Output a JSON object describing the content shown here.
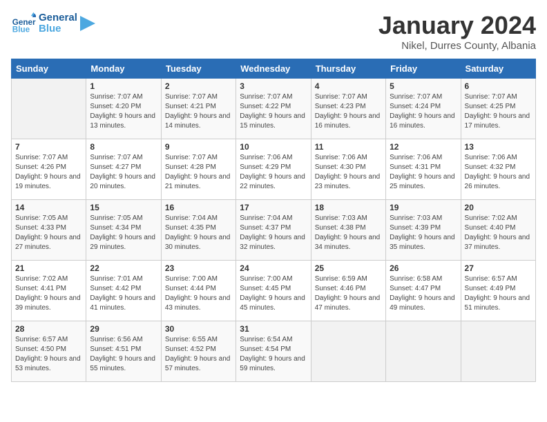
{
  "logo": {
    "text_general": "General",
    "text_blue": "Blue"
  },
  "header": {
    "month_year": "January 2024",
    "location": "Nikel, Durres County, Albania"
  },
  "days_of_week": [
    "Sunday",
    "Monday",
    "Tuesday",
    "Wednesday",
    "Thursday",
    "Friday",
    "Saturday"
  ],
  "weeks": [
    [
      {
        "day": "",
        "sunrise": "",
        "sunset": "",
        "daylight": ""
      },
      {
        "day": "1",
        "sunrise": "Sunrise: 7:07 AM",
        "sunset": "Sunset: 4:20 PM",
        "daylight": "Daylight: 9 hours and 13 minutes."
      },
      {
        "day": "2",
        "sunrise": "Sunrise: 7:07 AM",
        "sunset": "Sunset: 4:21 PM",
        "daylight": "Daylight: 9 hours and 14 minutes."
      },
      {
        "day": "3",
        "sunrise": "Sunrise: 7:07 AM",
        "sunset": "Sunset: 4:22 PM",
        "daylight": "Daylight: 9 hours and 15 minutes."
      },
      {
        "day": "4",
        "sunrise": "Sunrise: 7:07 AM",
        "sunset": "Sunset: 4:23 PM",
        "daylight": "Daylight: 9 hours and 16 minutes."
      },
      {
        "day": "5",
        "sunrise": "Sunrise: 7:07 AM",
        "sunset": "Sunset: 4:24 PM",
        "daylight": "Daylight: 9 hours and 16 minutes."
      },
      {
        "day": "6",
        "sunrise": "Sunrise: 7:07 AM",
        "sunset": "Sunset: 4:25 PM",
        "daylight": "Daylight: 9 hours and 17 minutes."
      }
    ],
    [
      {
        "day": "7",
        "sunrise": "Sunrise: 7:07 AM",
        "sunset": "Sunset: 4:26 PM",
        "daylight": "Daylight: 9 hours and 19 minutes."
      },
      {
        "day": "8",
        "sunrise": "Sunrise: 7:07 AM",
        "sunset": "Sunset: 4:27 PM",
        "daylight": "Daylight: 9 hours and 20 minutes."
      },
      {
        "day": "9",
        "sunrise": "Sunrise: 7:07 AM",
        "sunset": "Sunset: 4:28 PM",
        "daylight": "Daylight: 9 hours and 21 minutes."
      },
      {
        "day": "10",
        "sunrise": "Sunrise: 7:06 AM",
        "sunset": "Sunset: 4:29 PM",
        "daylight": "Daylight: 9 hours and 22 minutes."
      },
      {
        "day": "11",
        "sunrise": "Sunrise: 7:06 AM",
        "sunset": "Sunset: 4:30 PM",
        "daylight": "Daylight: 9 hours and 23 minutes."
      },
      {
        "day": "12",
        "sunrise": "Sunrise: 7:06 AM",
        "sunset": "Sunset: 4:31 PM",
        "daylight": "Daylight: 9 hours and 25 minutes."
      },
      {
        "day": "13",
        "sunrise": "Sunrise: 7:06 AM",
        "sunset": "Sunset: 4:32 PM",
        "daylight": "Daylight: 9 hours and 26 minutes."
      }
    ],
    [
      {
        "day": "14",
        "sunrise": "Sunrise: 7:05 AM",
        "sunset": "Sunset: 4:33 PM",
        "daylight": "Daylight: 9 hours and 27 minutes."
      },
      {
        "day": "15",
        "sunrise": "Sunrise: 7:05 AM",
        "sunset": "Sunset: 4:34 PM",
        "daylight": "Daylight: 9 hours and 29 minutes."
      },
      {
        "day": "16",
        "sunrise": "Sunrise: 7:04 AM",
        "sunset": "Sunset: 4:35 PM",
        "daylight": "Daylight: 9 hours and 30 minutes."
      },
      {
        "day": "17",
        "sunrise": "Sunrise: 7:04 AM",
        "sunset": "Sunset: 4:37 PM",
        "daylight": "Daylight: 9 hours and 32 minutes."
      },
      {
        "day": "18",
        "sunrise": "Sunrise: 7:03 AM",
        "sunset": "Sunset: 4:38 PM",
        "daylight": "Daylight: 9 hours and 34 minutes."
      },
      {
        "day": "19",
        "sunrise": "Sunrise: 7:03 AM",
        "sunset": "Sunset: 4:39 PM",
        "daylight": "Daylight: 9 hours and 35 minutes."
      },
      {
        "day": "20",
        "sunrise": "Sunrise: 7:02 AM",
        "sunset": "Sunset: 4:40 PM",
        "daylight": "Daylight: 9 hours and 37 minutes."
      }
    ],
    [
      {
        "day": "21",
        "sunrise": "Sunrise: 7:02 AM",
        "sunset": "Sunset: 4:41 PM",
        "daylight": "Daylight: 9 hours and 39 minutes."
      },
      {
        "day": "22",
        "sunrise": "Sunrise: 7:01 AM",
        "sunset": "Sunset: 4:42 PM",
        "daylight": "Daylight: 9 hours and 41 minutes."
      },
      {
        "day": "23",
        "sunrise": "Sunrise: 7:00 AM",
        "sunset": "Sunset: 4:44 PM",
        "daylight": "Daylight: 9 hours and 43 minutes."
      },
      {
        "day": "24",
        "sunrise": "Sunrise: 7:00 AM",
        "sunset": "Sunset: 4:45 PM",
        "daylight": "Daylight: 9 hours and 45 minutes."
      },
      {
        "day": "25",
        "sunrise": "Sunrise: 6:59 AM",
        "sunset": "Sunset: 4:46 PM",
        "daylight": "Daylight: 9 hours and 47 minutes."
      },
      {
        "day": "26",
        "sunrise": "Sunrise: 6:58 AM",
        "sunset": "Sunset: 4:47 PM",
        "daylight": "Daylight: 9 hours and 49 minutes."
      },
      {
        "day": "27",
        "sunrise": "Sunrise: 6:57 AM",
        "sunset": "Sunset: 4:49 PM",
        "daylight": "Daylight: 9 hours and 51 minutes."
      }
    ],
    [
      {
        "day": "28",
        "sunrise": "Sunrise: 6:57 AM",
        "sunset": "Sunset: 4:50 PM",
        "daylight": "Daylight: 9 hours and 53 minutes."
      },
      {
        "day": "29",
        "sunrise": "Sunrise: 6:56 AM",
        "sunset": "Sunset: 4:51 PM",
        "daylight": "Daylight: 9 hours and 55 minutes."
      },
      {
        "day": "30",
        "sunrise": "Sunrise: 6:55 AM",
        "sunset": "Sunset: 4:52 PM",
        "daylight": "Daylight: 9 hours and 57 minutes."
      },
      {
        "day": "31",
        "sunrise": "Sunrise: 6:54 AM",
        "sunset": "Sunset: 4:54 PM",
        "daylight": "Daylight: 9 hours and 59 minutes."
      },
      {
        "day": "",
        "sunrise": "",
        "sunset": "",
        "daylight": ""
      },
      {
        "day": "",
        "sunrise": "",
        "sunset": "",
        "daylight": ""
      },
      {
        "day": "",
        "sunrise": "",
        "sunset": "",
        "daylight": ""
      }
    ]
  ]
}
